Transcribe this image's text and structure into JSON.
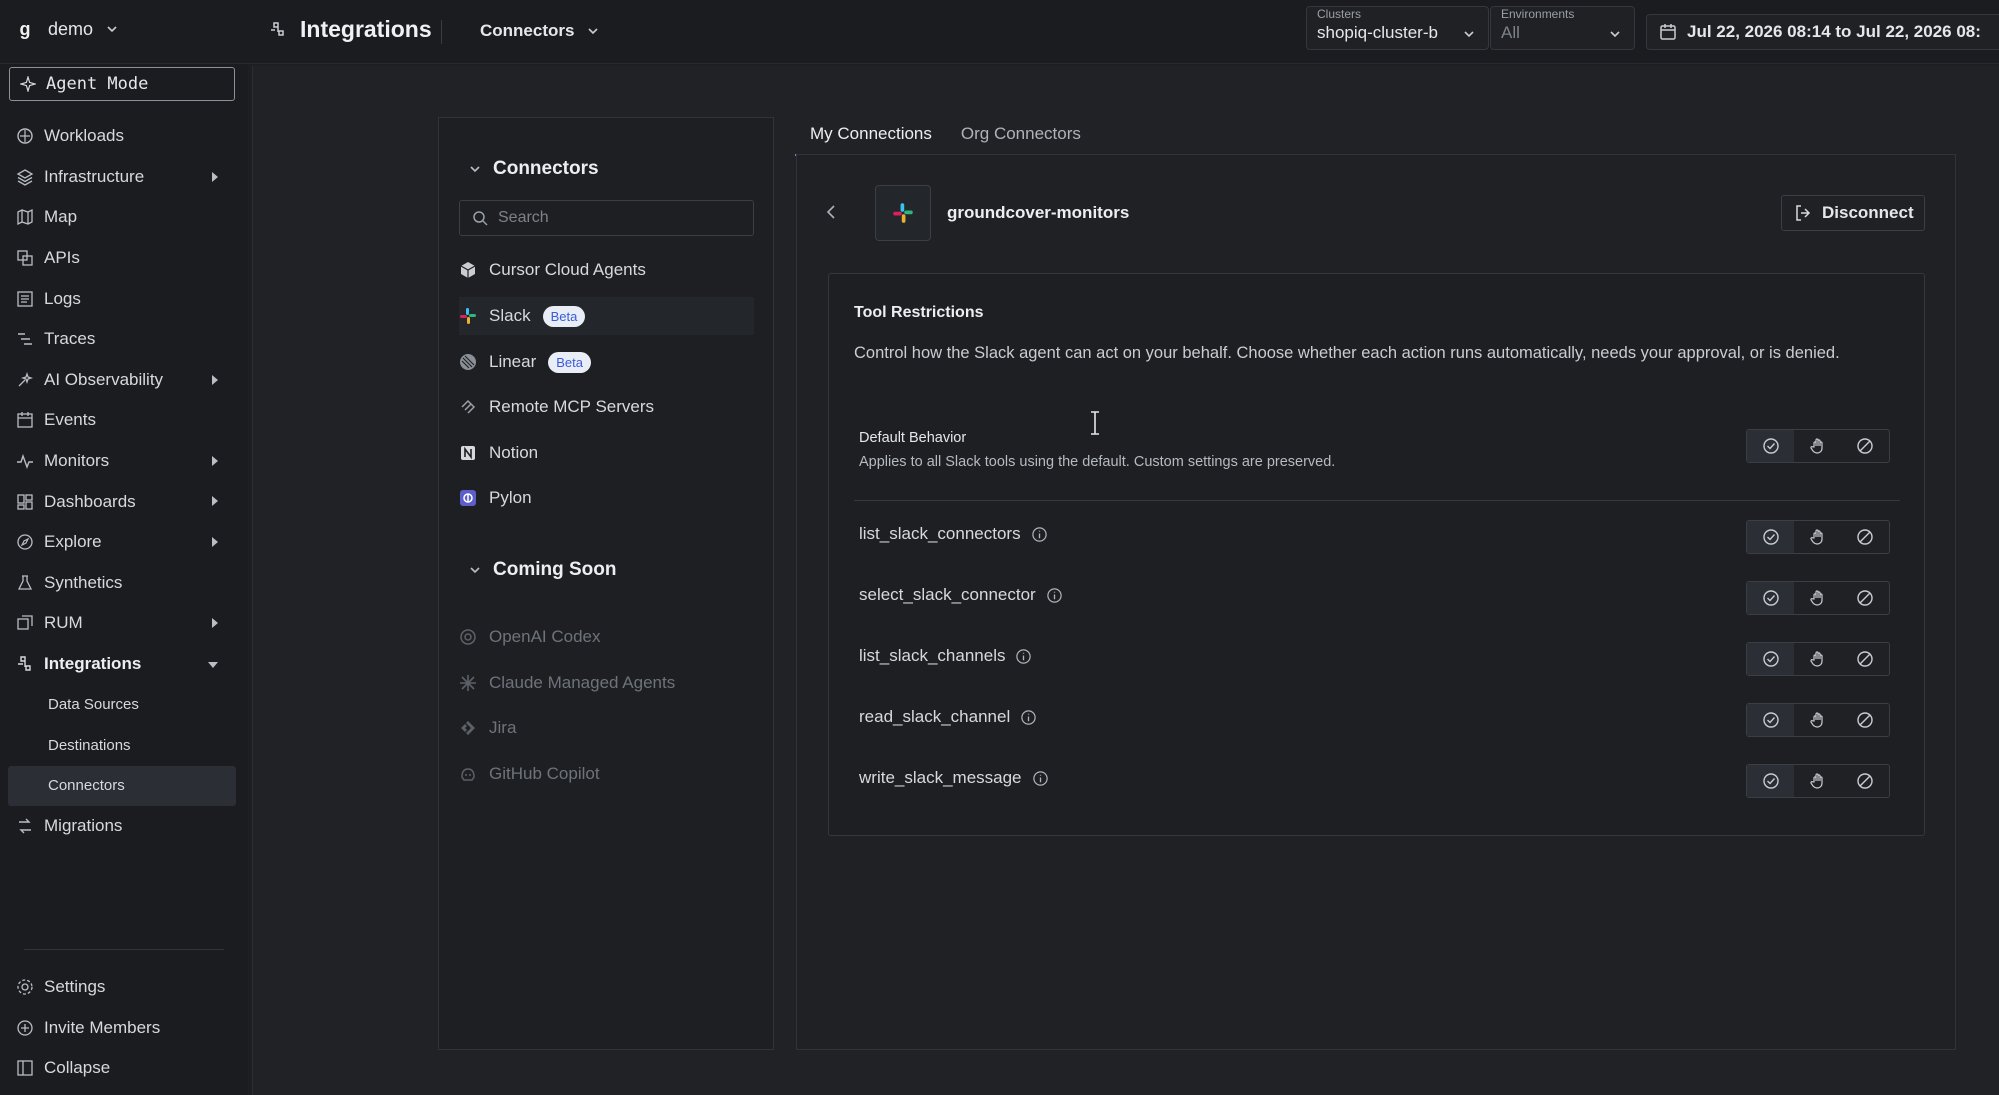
{
  "org": {
    "logo": "g",
    "name": "demo"
  },
  "header": {
    "title": "Integrations",
    "tab_select": "Connectors",
    "clusters_label": "Clusters",
    "clusters_value": "shopiq-cluster-b",
    "environments_label": "Environments",
    "environments_value": "All",
    "date_range": "Jul 22, 2026 08:14 to Jul 22, 2026 08:"
  },
  "sidebar": {
    "agent_mode": "Agent Mode",
    "items": [
      {
        "label": "Workloads",
        "icon": "workloads-icon",
        "expandable": false
      },
      {
        "label": "Infrastructure",
        "icon": "layers-icon",
        "expandable": true
      },
      {
        "label": "Map",
        "icon": "map-icon",
        "expandable": false
      },
      {
        "label": "APIs",
        "icon": "api-icon",
        "expandable": false
      },
      {
        "label": "Logs",
        "icon": "logs-icon",
        "expandable": false
      },
      {
        "label": "Traces",
        "icon": "traces-icon",
        "expandable": false
      },
      {
        "label": "AI Observability",
        "icon": "ai-icon",
        "expandable": true
      },
      {
        "label": "Events",
        "icon": "calendar-icon",
        "expandable": false
      },
      {
        "label": "Monitors",
        "icon": "pulse-icon",
        "expandable": true
      },
      {
        "label": "Dashboards",
        "icon": "dashboard-icon",
        "expandable": true
      },
      {
        "label": "Explore",
        "icon": "compass-icon",
        "expandable": true
      },
      {
        "label": "Synthetics",
        "icon": "flask-icon",
        "expandable": false
      },
      {
        "label": "RUM",
        "icon": "rum-icon",
        "expandable": true
      },
      {
        "label": "Integrations",
        "icon": "integrations-icon",
        "expandable": true
      }
    ],
    "integrations_sub": [
      "Data Sources",
      "Destinations",
      "Connectors"
    ],
    "migrations": "Migrations",
    "bottom": [
      "Settings",
      "Invite Members",
      "Collapse"
    ]
  },
  "connectors_panel": {
    "heading": "Connectors",
    "search_placeholder": "Search",
    "items": [
      {
        "label": "Cursor Cloud Agents",
        "badge": ""
      },
      {
        "label": "Slack",
        "badge": "Beta"
      },
      {
        "label": "Linear",
        "badge": "Beta"
      },
      {
        "label": "Remote MCP Servers",
        "badge": ""
      },
      {
        "label": "Notion",
        "badge": ""
      },
      {
        "label": "Pylon",
        "badge": ""
      }
    ],
    "coming_soon_heading": "Coming Soon",
    "coming_soon": [
      "OpenAI Codex",
      "Claude Managed Agents",
      "Jira",
      "GitHub Copilot"
    ]
  },
  "tabs": [
    "My Connections",
    "Org Connectors"
  ],
  "connection": {
    "name": "groundcover-monitors",
    "disconnect": "Disconnect",
    "tool_restrictions_title": "Tool Restrictions",
    "tool_restrictions_desc": "Control how the Slack agent can act on your behalf. Choose whether each action runs automatically, needs your approval, or is denied.",
    "default_title": "Default Behavior",
    "default_sub": "Applies to all Slack tools using the default. Custom settings are preserved.",
    "tools": [
      "list_slack_connectors",
      "select_slack_connector",
      "list_slack_channels",
      "read_slack_channel",
      "write_slack_message"
    ]
  },
  "colors": {
    "accent": "#6a8ad6",
    "beta_bg": "#e9edf6",
    "beta_text": "#3b5bdb"
  }
}
